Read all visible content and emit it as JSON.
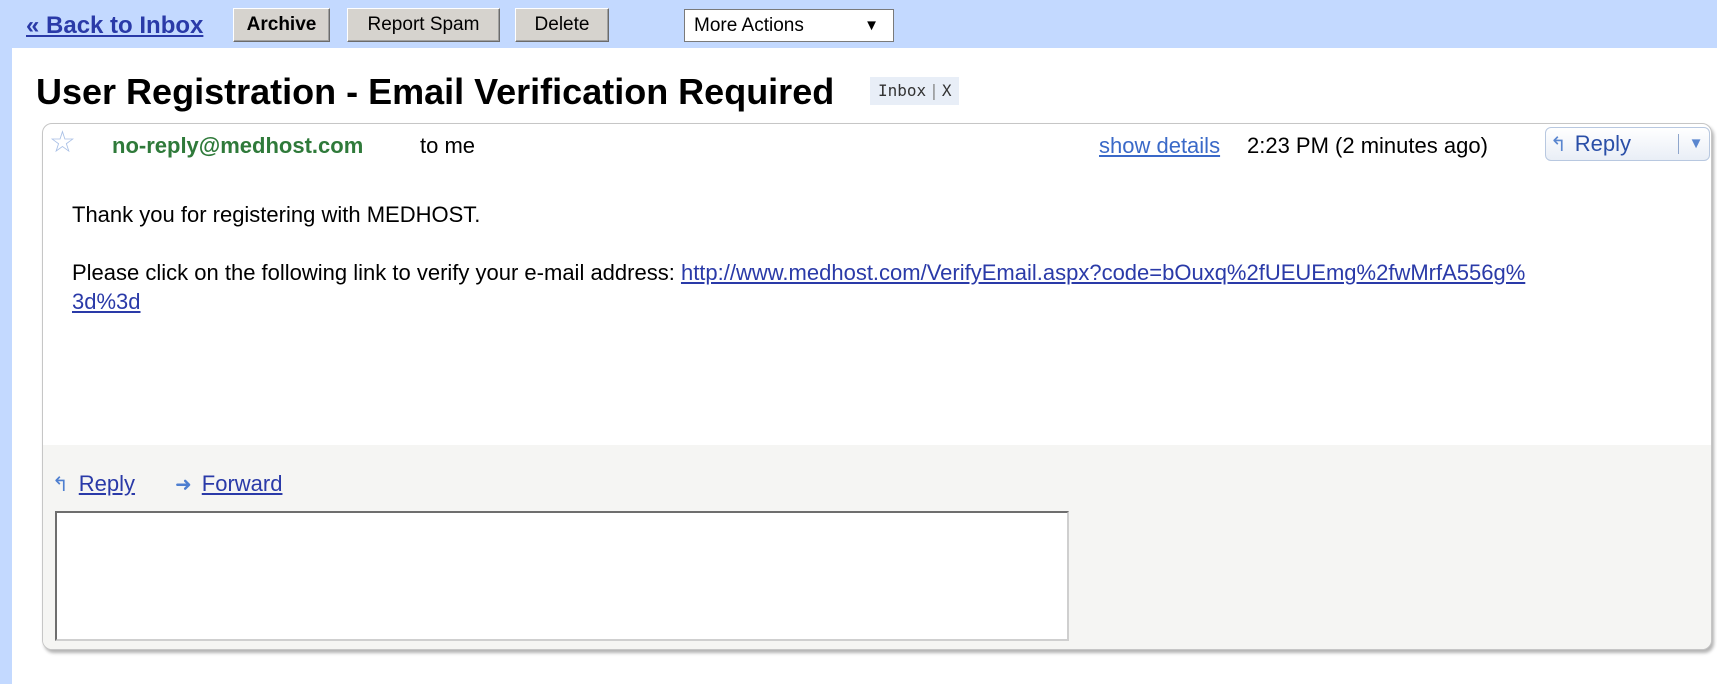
{
  "toolbar": {
    "back_label": "« Back to Inbox",
    "archive_label": "Archive",
    "spam_label": "Report Spam",
    "delete_label": "Delete",
    "more_actions_label": "More Actions",
    "caret": "▼"
  },
  "message": {
    "subject": "User Registration - Email Verification Required",
    "label": "Inbox",
    "label_separator": "|",
    "label_remove": "X",
    "sender": "no-reply@medhost.com",
    "recipient": "to me",
    "show_details": "show details",
    "timestamp": "2:23 PM (2 minutes ago)",
    "reply_label": "Reply",
    "reply_dropdown": "▼",
    "body_line1": "Thank you for registering with MEDHOST.",
    "body_line2_text": "Please click on the following link to verify your e-mail address:",
    "verify_link": "http://www.medhost.com/VerifyEmail.aspx?code=bOuxq%2fUEUEmg%2fwMrfA556g%3d%3d"
  },
  "quick_actions": {
    "reply_label": "Reply",
    "forward_label": "Forward"
  },
  "icons": {
    "star": "☆",
    "reply_arrow": "↰",
    "forward_arrow": "➜"
  },
  "colors": {
    "toolbar_bg": "#c3d9ff",
    "link": "#2a3aa8",
    "sender": "#2f7a3a"
  }
}
